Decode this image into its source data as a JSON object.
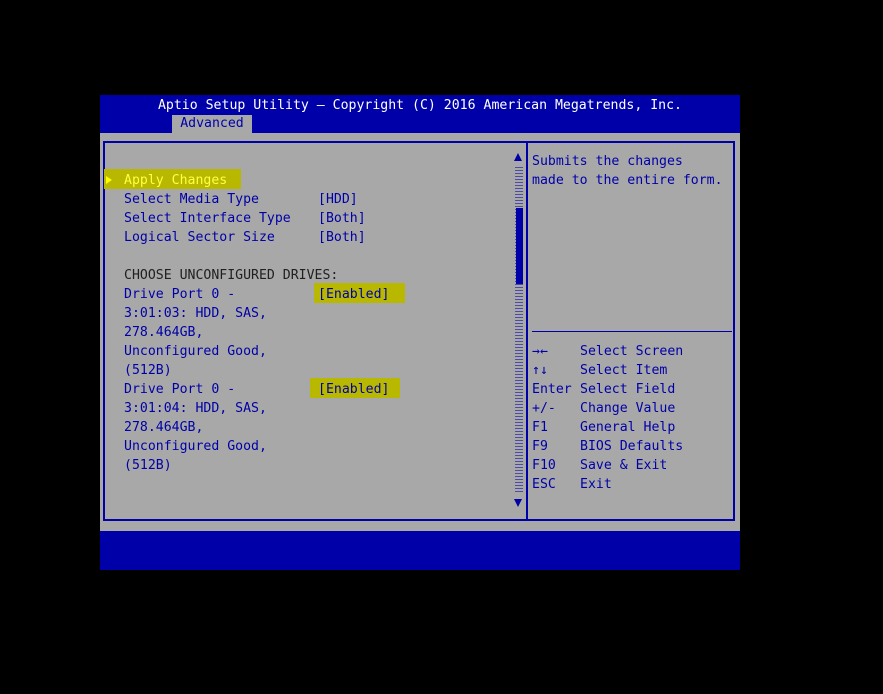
{
  "header": {
    "title": "Aptio Setup Utility – Copyright (C) 2016 American Megatrends, Inc.",
    "tab": "Advanced"
  },
  "menu": {
    "apply_changes": "Apply Changes",
    "items": [
      {
        "label": "Select Media Type",
        "value": "[HDD]"
      },
      {
        "label": "Select Interface Type",
        "value": "[Both]"
      },
      {
        "label": "Logical Sector Size",
        "value": "[Both]"
      }
    ],
    "section_heading": "CHOOSE UNCONFIGURED DRIVES:",
    "drives": [
      {
        "lines": [
          "Drive Port 0 -",
          "3:01:03: HDD, SAS,",
          "278.464GB,",
          "Unconfigured Good,",
          "(512B)"
        ],
        "value": "[Enabled]"
      },
      {
        "lines": [
          "Drive Port 0 -",
          "3:01:04: HDD, SAS,",
          "278.464GB,",
          "Unconfigured Good,",
          "(512B)"
        ],
        "value": "[Enabled]"
      }
    ]
  },
  "help": {
    "description": [
      "Submits the changes",
      "made to the entire form."
    ],
    "keys": [
      {
        "key": "→←",
        "desc": "Select Screen"
      },
      {
        "key": "↑↓",
        "desc": "Select Item"
      },
      {
        "key": "Enter",
        "desc": "Select Field"
      },
      {
        "key": "+/-",
        "desc": "Change Value"
      },
      {
        "key": "F1",
        "desc": "General Help"
      },
      {
        "key": "F9",
        "desc": "BIOS Defaults"
      },
      {
        "key": "F10",
        "desc": "Save & Exit"
      },
      {
        "key": "ESC",
        "desc": "Exit"
      }
    ]
  },
  "colors": {
    "background": "#000000",
    "panel": "#a8a8a8",
    "bar": "#0000a8",
    "highlight": "#b8b800",
    "selected_text": "#ffff40"
  }
}
